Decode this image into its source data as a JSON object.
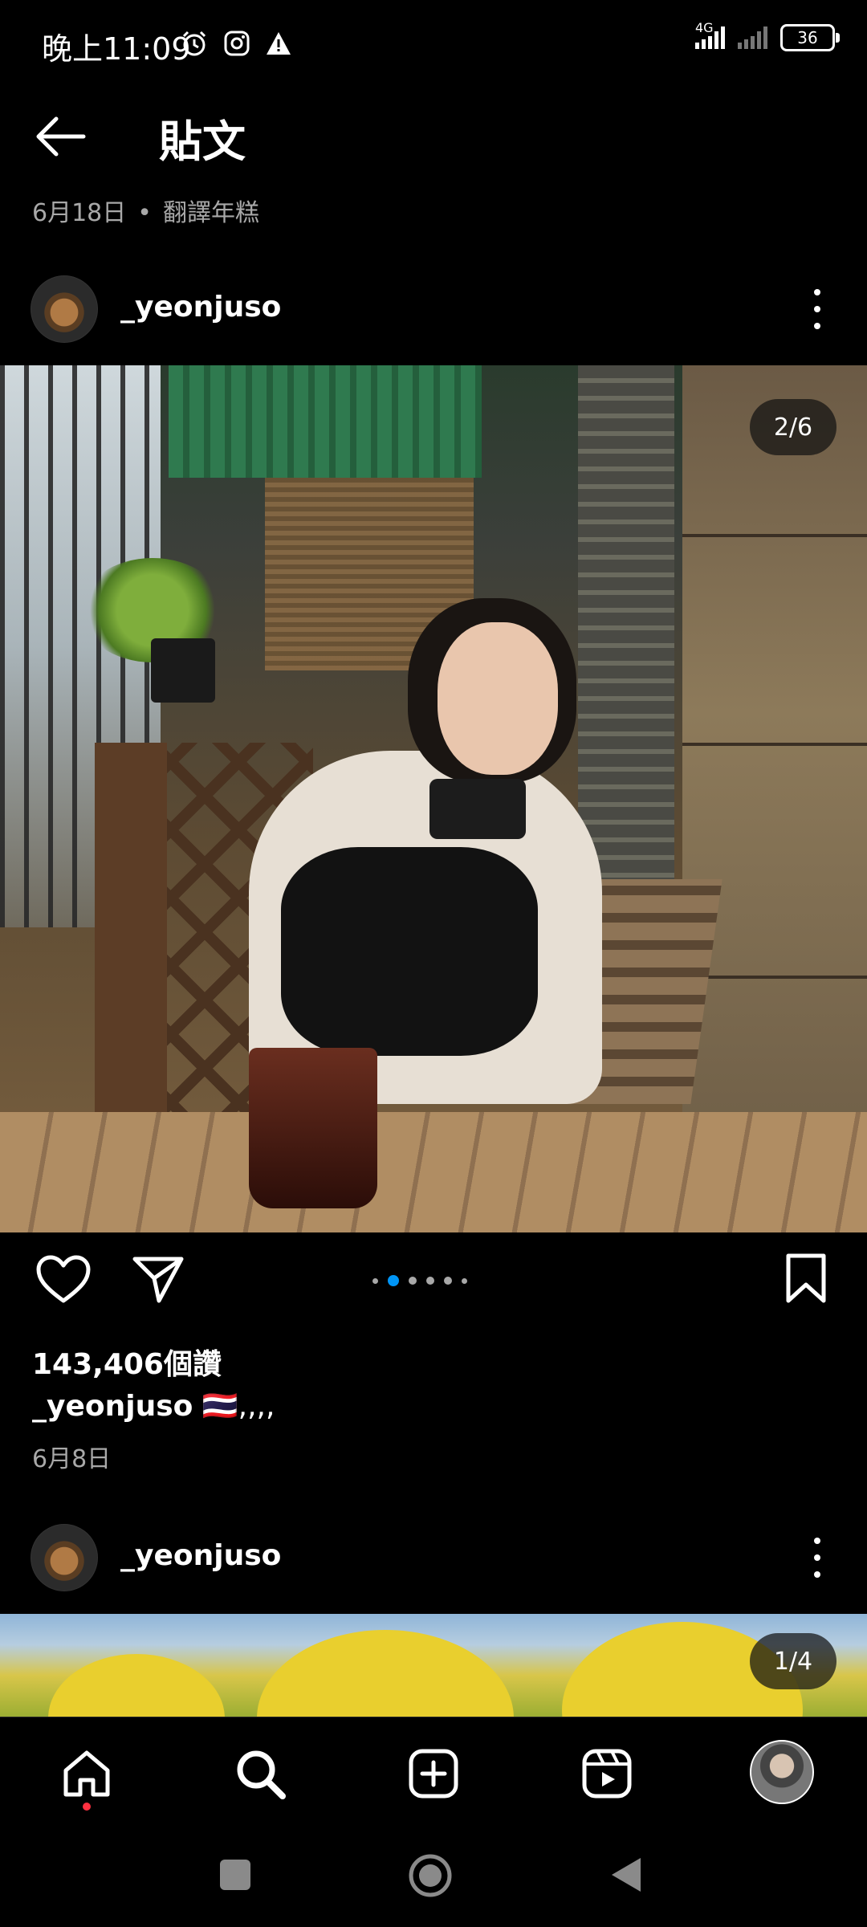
{
  "status_bar": {
    "time": "晚上11:09",
    "network_label": "4G",
    "battery": "36"
  },
  "header": {
    "title": "貼文",
    "date": "6月18日",
    "separator": "•",
    "translate_link": "翻譯年糕"
  },
  "post": {
    "username": "_yeonjuso",
    "image_counter": "2/6",
    "pager": {
      "count": 6,
      "active_index": 1
    },
    "likes": "143,406個讚",
    "caption_text": "🇹🇭,,,,",
    "date": "6月8日"
  },
  "next_post": {
    "username": "_yeonjuso",
    "image_counter": "1/4"
  },
  "icons": {
    "back": "back-arrow-icon",
    "more": "more-icon",
    "like": "heart-icon",
    "share": "send-icon",
    "save": "bookmark-icon",
    "home": "home-icon",
    "search": "search-icon",
    "create": "add-icon",
    "reels": "reels-icon"
  },
  "colors": {
    "background": "#000000",
    "text": "#ffffff",
    "muted": "#a8a8a8",
    "accent": "#0095f6",
    "notification": "#ff3040"
  }
}
